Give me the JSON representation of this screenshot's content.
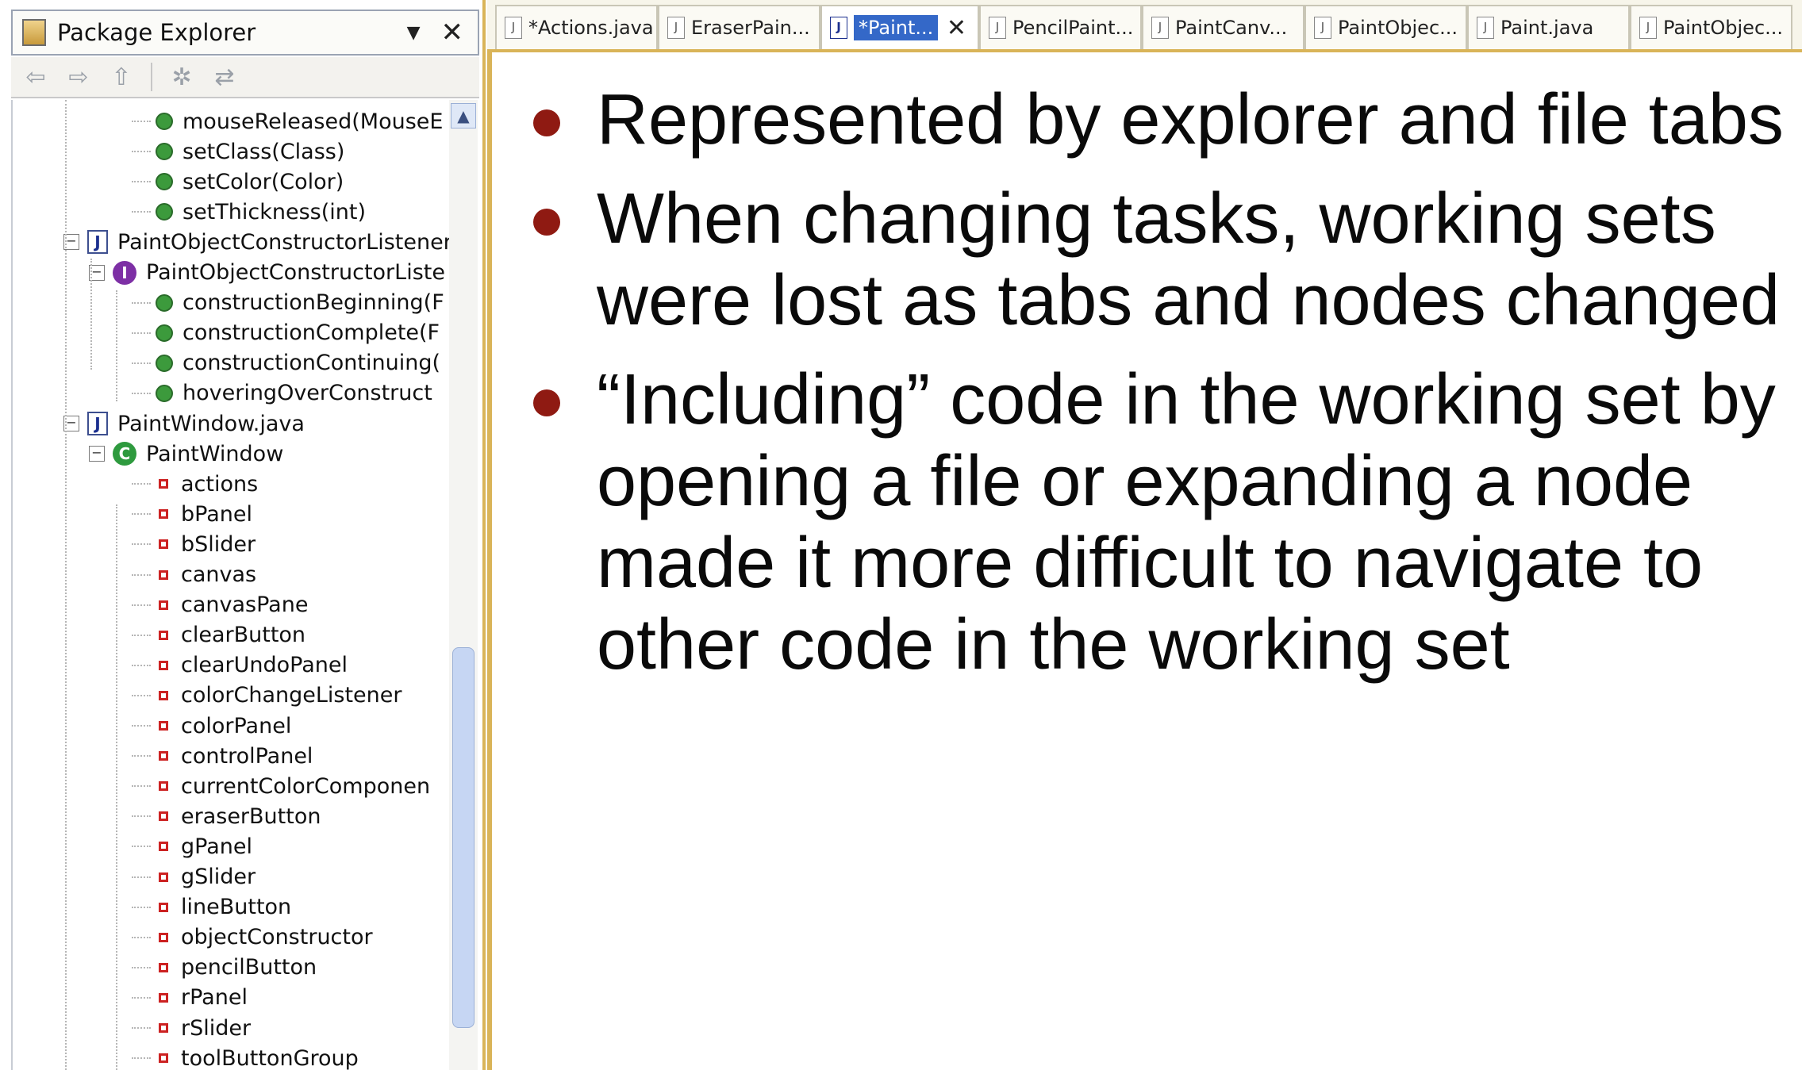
{
  "explorer": {
    "title": "Package Explorer",
    "menu_icon": "chevron-down-icon",
    "close_label": "✕",
    "toolbar": [
      {
        "icon": "back-arrow-icon",
        "glyph": "⇦"
      },
      {
        "icon": "forward-arrow-icon",
        "glyph": "⇨"
      },
      {
        "icon": "up-folder-icon",
        "glyph": "⇧"
      },
      {
        "icon": "collapse-all-icon",
        "glyph": "✲"
      },
      {
        "icon": "link-editor-icon",
        "glyph": "⇄"
      }
    ],
    "tree": [
      {
        "kind": "method",
        "depth": 3,
        "label": "mouseReleased(MouseE"
      },
      {
        "kind": "method",
        "depth": 3,
        "label": "setClass(Class)"
      },
      {
        "kind": "method",
        "depth": 3,
        "label": "setColor(Color)"
      },
      {
        "kind": "method",
        "depth": 3,
        "label": "setThickness(int)"
      },
      {
        "kind": "file",
        "depth": 1,
        "label": "PaintObjectConstructorListener",
        "toggle": "−"
      },
      {
        "kind": "interface",
        "depth": 2,
        "label": "PaintObjectConstructorListe",
        "toggle": "−"
      },
      {
        "kind": "method",
        "depth": 3,
        "label": "constructionBeginning(F"
      },
      {
        "kind": "method",
        "depth": 3,
        "label": "constructionComplete(F"
      },
      {
        "kind": "method",
        "depth": 3,
        "label": "constructionContinuing("
      },
      {
        "kind": "method",
        "depth": 3,
        "label": "hoveringOverConstruct"
      },
      {
        "kind": "file",
        "depth": 1,
        "label": "PaintWindow.java",
        "toggle": "−"
      },
      {
        "kind": "class",
        "depth": 2,
        "label": "PaintWindow",
        "toggle": "−"
      },
      {
        "kind": "field",
        "depth": 3,
        "label": "actions"
      },
      {
        "kind": "field",
        "depth": 3,
        "label": "bPanel"
      },
      {
        "kind": "field",
        "depth": 3,
        "label": "bSlider"
      },
      {
        "kind": "field",
        "depth": 3,
        "label": "canvas"
      },
      {
        "kind": "field",
        "depth": 3,
        "label": "canvasPane"
      },
      {
        "kind": "field",
        "depth": 3,
        "label": "clearButton"
      },
      {
        "kind": "field",
        "depth": 3,
        "label": "clearUndoPanel"
      },
      {
        "kind": "field",
        "depth": 3,
        "label": "colorChangeListener"
      },
      {
        "kind": "field",
        "depth": 3,
        "label": "colorPanel"
      },
      {
        "kind": "field",
        "depth": 3,
        "label": "controlPanel"
      },
      {
        "kind": "field",
        "depth": 3,
        "label": "currentColorComponen"
      },
      {
        "kind": "field",
        "depth": 3,
        "label": "eraserButton"
      },
      {
        "kind": "field",
        "depth": 3,
        "label": "gPanel"
      },
      {
        "kind": "field",
        "depth": 3,
        "label": "gSlider"
      },
      {
        "kind": "field",
        "depth": 3,
        "label": "lineButton"
      },
      {
        "kind": "field",
        "depth": 3,
        "label": "objectConstructor"
      },
      {
        "kind": "field",
        "depth": 3,
        "label": "pencilButton"
      },
      {
        "kind": "field",
        "depth": 3,
        "label": "rPanel"
      },
      {
        "kind": "field",
        "depth": 3,
        "label": "rSlider"
      },
      {
        "kind": "field",
        "depth": 3,
        "label": "toolButtonGroup"
      }
    ]
  },
  "tabs": [
    {
      "label": "*Actions.java",
      "active": false
    },
    {
      "label": "EraserPain...",
      "active": false
    },
    {
      "label": "*Paint...",
      "active": true,
      "close": "✕"
    },
    {
      "label": "PencilPaint...",
      "active": false
    },
    {
      "label": "PaintCanv...",
      "active": false
    },
    {
      "label": "PaintObjec...",
      "active": false
    },
    {
      "label": "Paint.java",
      "active": false
    },
    {
      "label": "PaintObjec...",
      "active": false
    }
  ],
  "slide": {
    "bullet_color": "#8f1a12",
    "bullets": [
      "Represented by explorer and file tabs",
      "When changing tasks, working sets were lost as tabs and nodes changed",
      "“Including” code in the working set by opening a file or expanding a node made it more difficult to navigate to other code in the working set"
    ]
  }
}
